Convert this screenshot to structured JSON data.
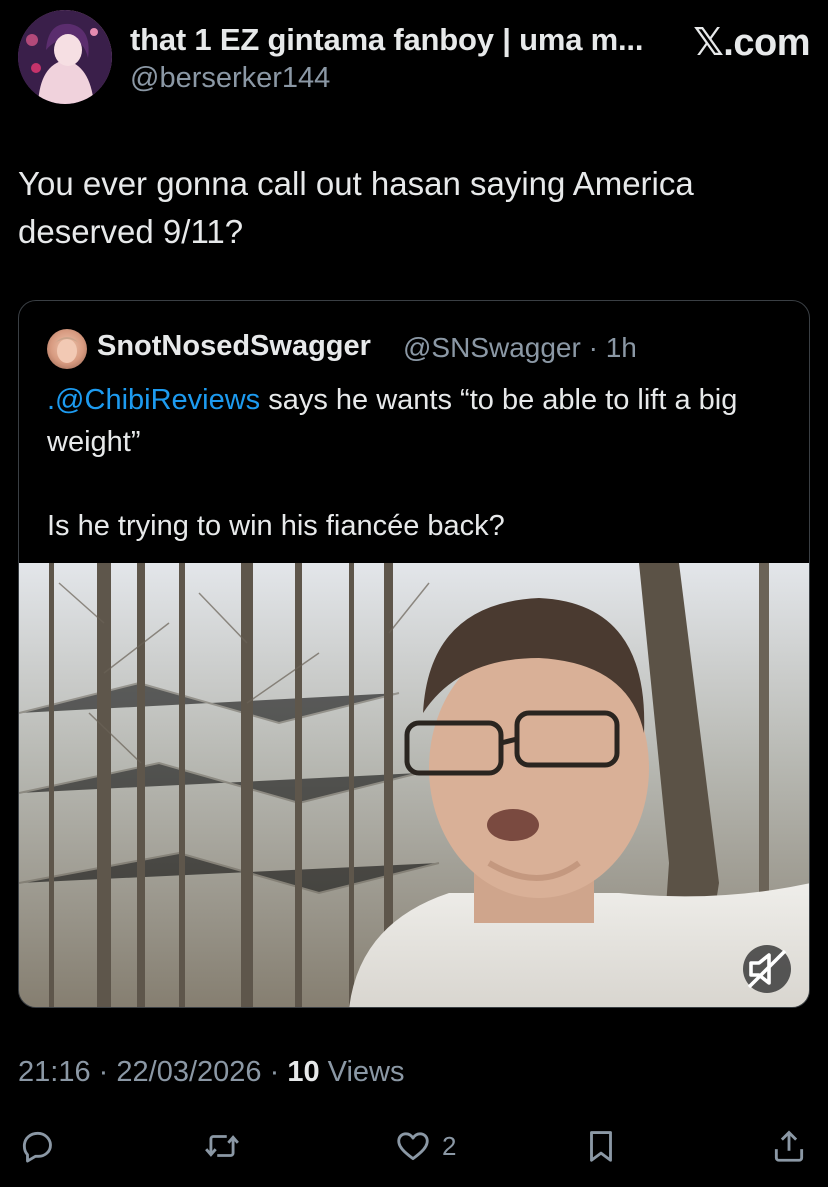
{
  "header": {
    "display_name": "that 1 EZ gintama fanboy | uma m...",
    "handle": "@berserker144",
    "brand": "𝕏.com"
  },
  "tweet": {
    "text": "You ever gonna call out hasan saying America deserved 9/11?"
  },
  "quote": {
    "display_name": "SnotNosedSwagger",
    "handle": "@SNSwagger",
    "separator": "·",
    "time": "1h",
    "mention": ".@ChibiReviews",
    "line1_rest": " says he wants “to be able to lift a big weight”",
    "line2": "Is he trying to win his fiancée back?"
  },
  "post": {
    "time": "21:16",
    "date": "22/03/2026",
    "sep": "·",
    "views_count": "10",
    "views_label": "Views"
  },
  "actions": {
    "likes_count": "2"
  },
  "icons": {
    "reply": "reply-icon",
    "retweet": "retweet-icon",
    "like": "heart-icon",
    "bookmark": "bookmark-icon",
    "share": "share-icon",
    "mute": "muted-speaker-icon"
  },
  "colors": {
    "background": "#000000",
    "text": "#e7e9ea",
    "secondary": "#8b98a5",
    "link": "#1d9bf0"
  }
}
